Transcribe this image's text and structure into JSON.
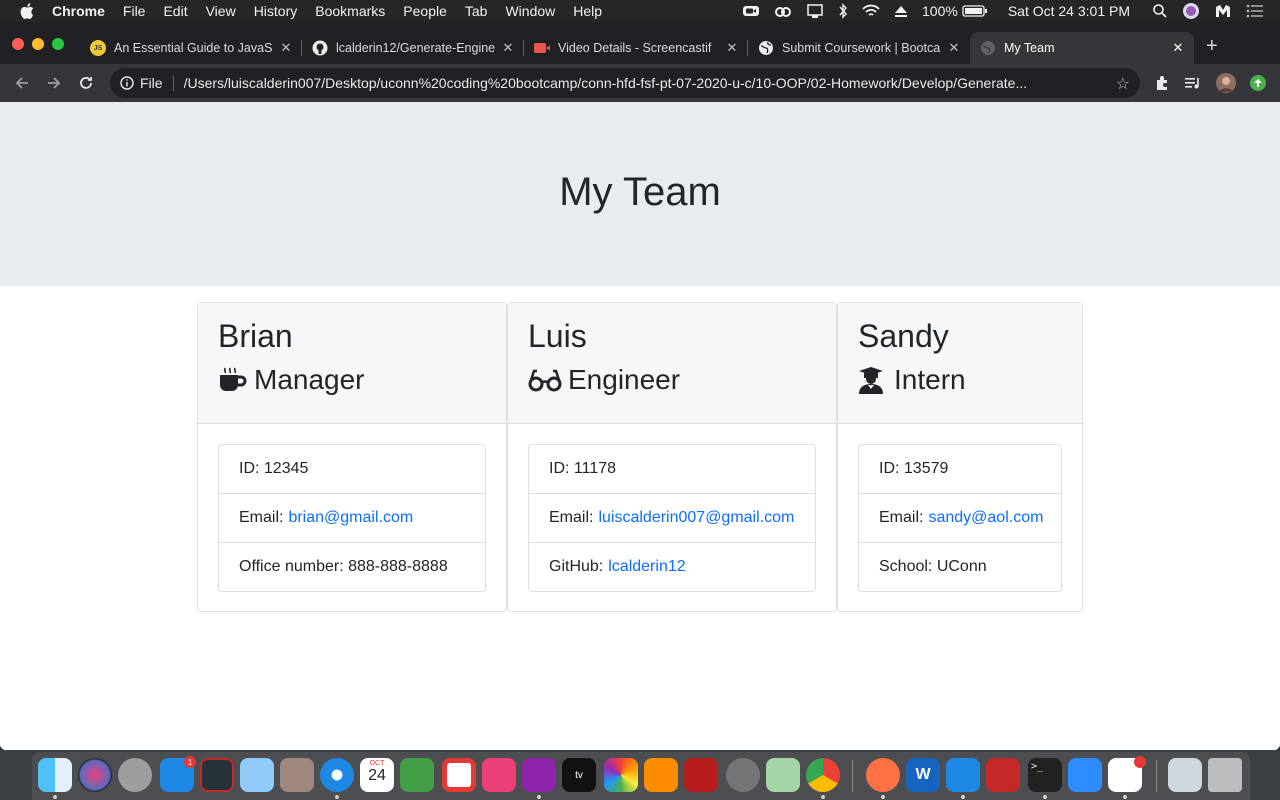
{
  "menubar": {
    "app_name": "Chrome",
    "items": [
      "File",
      "Edit",
      "View",
      "History",
      "Bookmarks",
      "People",
      "Tab",
      "Window",
      "Help"
    ],
    "battery": "100%",
    "datetime": "Sat Oct 24  3:01 PM"
  },
  "browser": {
    "tabs": [
      {
        "title": "An Essential Guide to JavaS",
        "favicon": "js-icon"
      },
      {
        "title": "lcalderin12/Generate-Engine",
        "favicon": "github-icon"
      },
      {
        "title": "Video Details - Screencastif",
        "favicon": "screencastify-icon"
      },
      {
        "title": "Submit Coursework | Bootca",
        "favicon": "globe-icon"
      },
      {
        "title": "My Team",
        "favicon": "globe-icon"
      }
    ],
    "address": {
      "protocol": "File",
      "url": "/Users/luiscalderin007/Desktop/uconn%20coding%20bootcamp/conn-hfd-fsf-pt-07-2020-u-c/10-OOP/02-Homework/Develop/Generate..."
    }
  },
  "page": {
    "title": "My Team",
    "team": [
      {
        "name": "Brian",
        "role": "Manager",
        "role_icon": "coffee-mug-icon",
        "id_text": "ID: 12345",
        "email_label": "Email:",
        "email": "brian@gmail.com",
        "extra_text": "Office number: 888-888-8888"
      },
      {
        "name": "Luis",
        "role": "Engineer",
        "role_icon": "glasses-icon",
        "id_text": "ID: 11178",
        "email_label": "Email:",
        "email": "luiscalderin007@gmail.com",
        "extra_label": "GitHub:",
        "extra_link": "lcalderin12"
      },
      {
        "name": "Sandy",
        "role": "Intern",
        "role_icon": "graduate-icon",
        "id_text": "ID: 13579",
        "email_label": "Email:",
        "email": "sandy@aol.com",
        "extra_text": "School: UConn"
      }
    ]
  },
  "dock": {
    "calendar_day": "24",
    "calendar_month": "OCT",
    "appstore_badge": "1"
  }
}
